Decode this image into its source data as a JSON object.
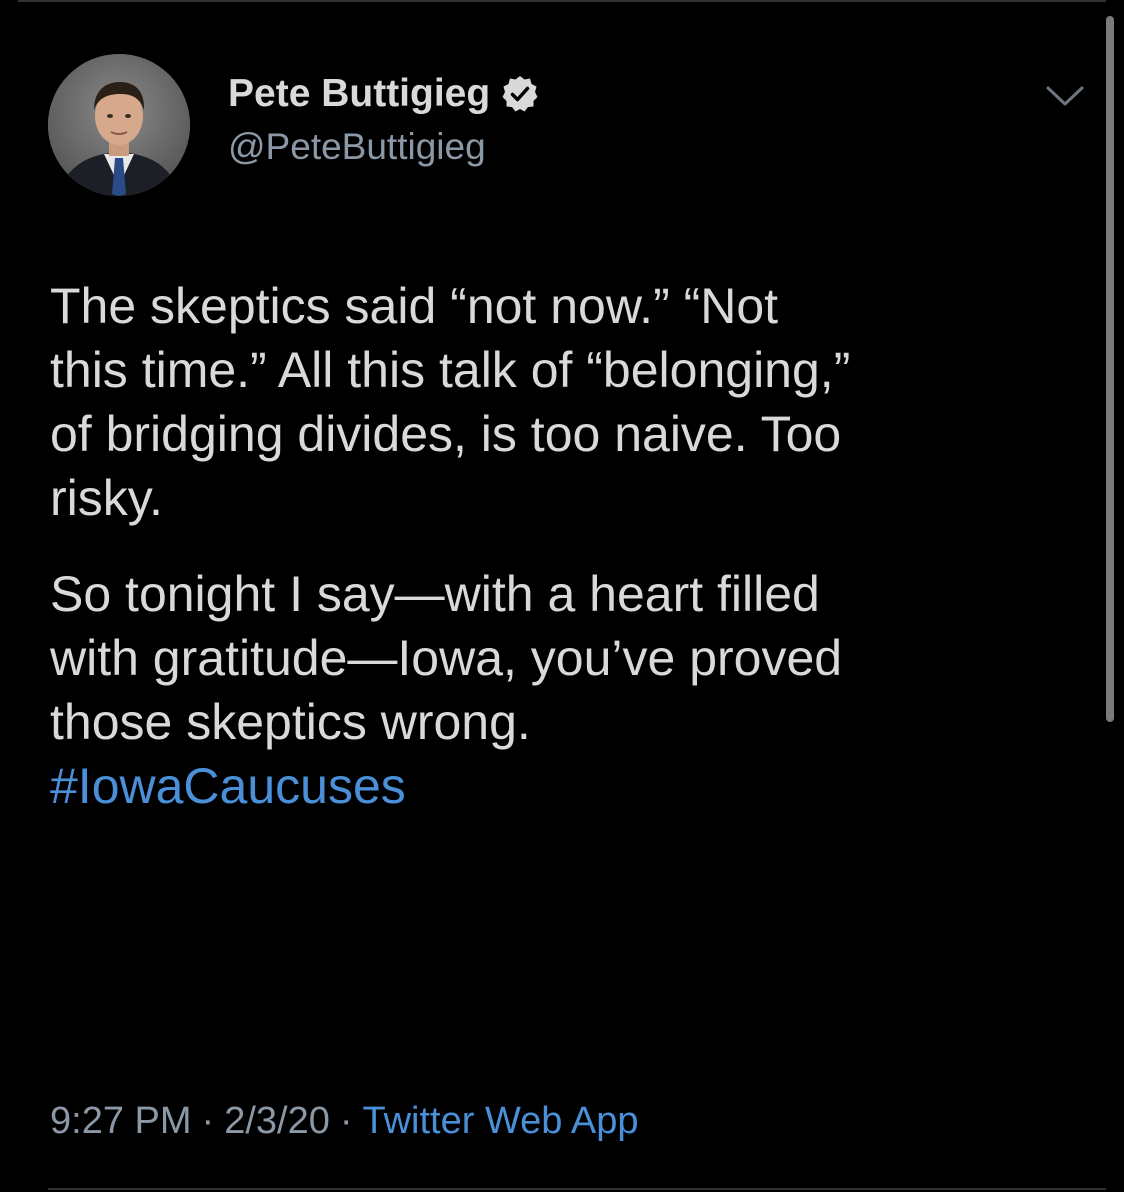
{
  "author": {
    "name": "Pete Buttigieg",
    "handle": "@PeteButtigieg",
    "verified": true,
    "avatar_icon": "profile-photo-avatar"
  },
  "tweet": {
    "paragraph1": [
      "The skeptics said “not now.” “Not",
      "this time.” All this talk of “belonging,”",
      "of bridging divides, is too naive. Too",
      "risky."
    ],
    "paragraph2": [
      "So tonight I say—with a heart filled",
      "with gratitude—Iowa, you’ve proved",
      "those skeptics wrong."
    ],
    "hashtag": "#IowaCaucuses"
  },
  "meta": {
    "time": "9:27 PM",
    "date": "2/3/20",
    "separator": "·",
    "source": "Twitter Web App"
  },
  "colors": {
    "background": "#000000",
    "text": "#d9d9d9",
    "secondary": "#8b98a5",
    "link": "#4a90d9"
  },
  "icons": {
    "verified": "verified-badge-icon",
    "menu": "chevron-down-icon"
  }
}
